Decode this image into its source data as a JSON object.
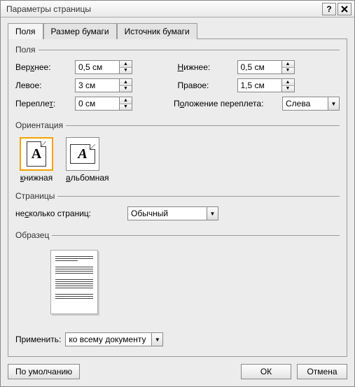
{
  "title": "Параметры страницы",
  "tabs": [
    "Поля",
    "Размер бумаги",
    "Источник бумаги"
  ],
  "fields_legend": "Поля",
  "fields": {
    "top_label": "Верхнее:",
    "top_val": "0,5 см",
    "bottom_label": "Нижнее:",
    "bottom_val": "0,5 см",
    "left_label": "Левое:",
    "left_val": "3 см",
    "right_label": "Правое:",
    "right_val": "1,5 см",
    "gutter_label": "Переплет:",
    "gutter_val": "0 см",
    "gutterpos_label": "Положение переплета:",
    "gutterpos_val": "Слева"
  },
  "orient_legend": "Ориентация",
  "orient": {
    "portrait": "книжная",
    "landscape": "альбомная"
  },
  "pages_legend": "Страницы",
  "pages": {
    "multi_label": "несколько страниц:",
    "multi_val": "Обычный"
  },
  "sample_legend": "Образец",
  "apply": {
    "label": "Применить:",
    "val": "ко всему документу"
  },
  "buttons": {
    "default": "По умолчанию",
    "ok": "ОК",
    "cancel": "Отмена"
  }
}
